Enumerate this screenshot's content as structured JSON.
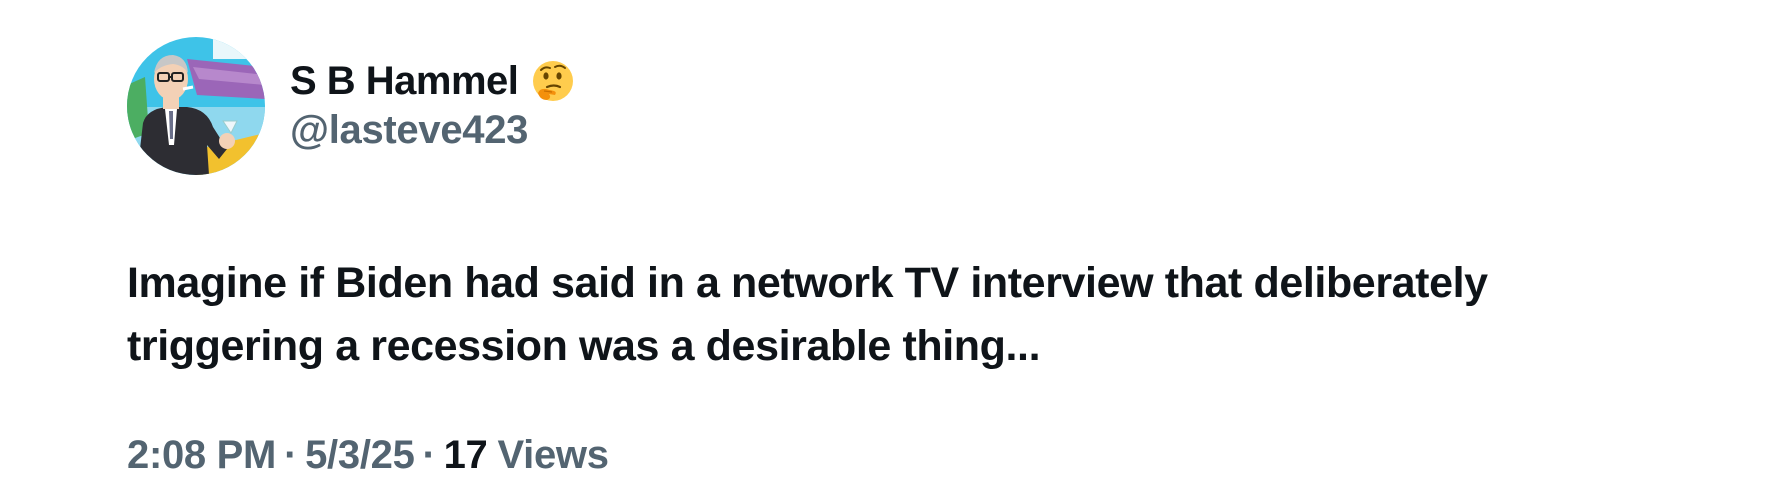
{
  "author": {
    "display_name": "S B Hammel",
    "name_emoji": "thinking-face-emoji",
    "handle": "@lasteve423"
  },
  "tweet": {
    "text": "Imagine if Biden had said in a network TV interview that deliberately triggering a recession was a desirable thing..."
  },
  "meta": {
    "time": "2:08 PM",
    "separator": "·",
    "date": "5/3/25",
    "views_count": "17",
    "views_label": "Views"
  },
  "colors": {
    "primary_text": "#0f1419",
    "secondary_text": "#536471",
    "background": "#ffffff"
  }
}
